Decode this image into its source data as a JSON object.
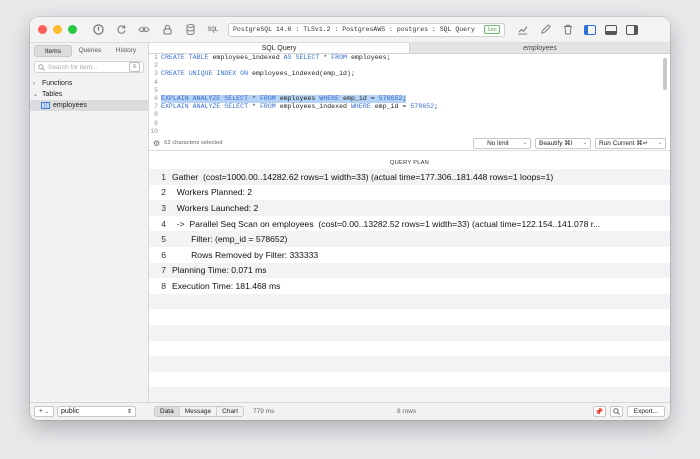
{
  "toolbar": {
    "connection_text": "PostgreSQL 14.6 : TLSv1.2 : PostgresAWS : postgres : SQL Query",
    "loc_badge": "loc",
    "sql_label": "SQL"
  },
  "sidebar": {
    "segments": [
      "Items",
      "Queries",
      "History"
    ],
    "search_placeholder": "Search for item...",
    "tree": [
      {
        "label": "Functions"
      },
      {
        "label": "Tables"
      },
      {
        "label": "employees"
      }
    ],
    "schema": "public"
  },
  "tabs": [
    "SQL Query",
    "employees"
  ],
  "editor": {
    "line_numbers": [
      "1",
      "2",
      "3",
      "4",
      "5",
      "6",
      "7",
      "8",
      "9",
      "10",
      "11"
    ],
    "selection_count": "62 characters selected",
    "limit": "No limit",
    "beautify": "Beautify ⌘I",
    "run": "Run Current ⌘↵",
    "code": {
      "l1_kw1": "CREATE TABLE",
      "l1_t1": " employees_indexed ",
      "l1_kw2": "AS SELECT",
      "l1_t2": " * ",
      "l1_kw3": "FROM",
      "l1_t3": " employees;",
      "l3_kw1": "CREATE UNIQUE INDEX ON",
      "l3_t1": " employees_indexed(emp_id);",
      "l6_kw1": "EXPLAIN ANALYZE SELECT",
      "l6_t1": " * ",
      "l6_kw2": "FROM",
      "l6_t2": " employees ",
      "l6_kw3": "WHERE",
      "l6_t3": " emp_id = ",
      "l6_num": "578652",
      "l6_t4": ";",
      "l7_kw1": "EXPLAIN ANALYZE SELECT",
      "l7_t1": " * ",
      "l7_kw2": "FROM",
      "l7_t2": " employees_indexed ",
      "l7_kw3": "WHERE",
      "l7_t3": " emp_id = ",
      "l7_num": "578652",
      "l7_t4": ";"
    }
  },
  "results": {
    "column": "QUERY PLAN",
    "rows": [
      {
        "n": "1",
        "text": "Gather  (cost=1000.00..14282.62 rows=1 width=33) (actual time=177.306..181.448 rows=1 loops=1)"
      },
      {
        "n": "2",
        "text": "  Workers Planned: 2"
      },
      {
        "n": "3",
        "text": "  Workers Launched: 2"
      },
      {
        "n": "4",
        "text": "  ->  Parallel Seq Scan on employees  (cost=0.00..13282.52 rows=1 width=33) (actual time=122.154..141.078 r..."
      },
      {
        "n": "5",
        "text": "        Filter: (emp_id = 578652)"
      },
      {
        "n": "6",
        "text": "        Rows Removed by Filter: 333333"
      },
      {
        "n": "7",
        "text": "Planning Time: 0.071 ms"
      },
      {
        "n": "8",
        "text": "Execution Time: 181.468 ms"
      },
      {
        "n": "",
        "text": ""
      },
      {
        "n": "",
        "text": ""
      },
      {
        "n": "",
        "text": ""
      },
      {
        "n": "",
        "text": ""
      },
      {
        "n": "",
        "text": ""
      },
      {
        "n": "",
        "text": ""
      },
      {
        "n": "",
        "text": ""
      }
    ]
  },
  "bottom": {
    "views": [
      "Data",
      "Message",
      "Chart"
    ],
    "duration": "779 ms",
    "row_count": "8 rows",
    "export": "Export..."
  }
}
